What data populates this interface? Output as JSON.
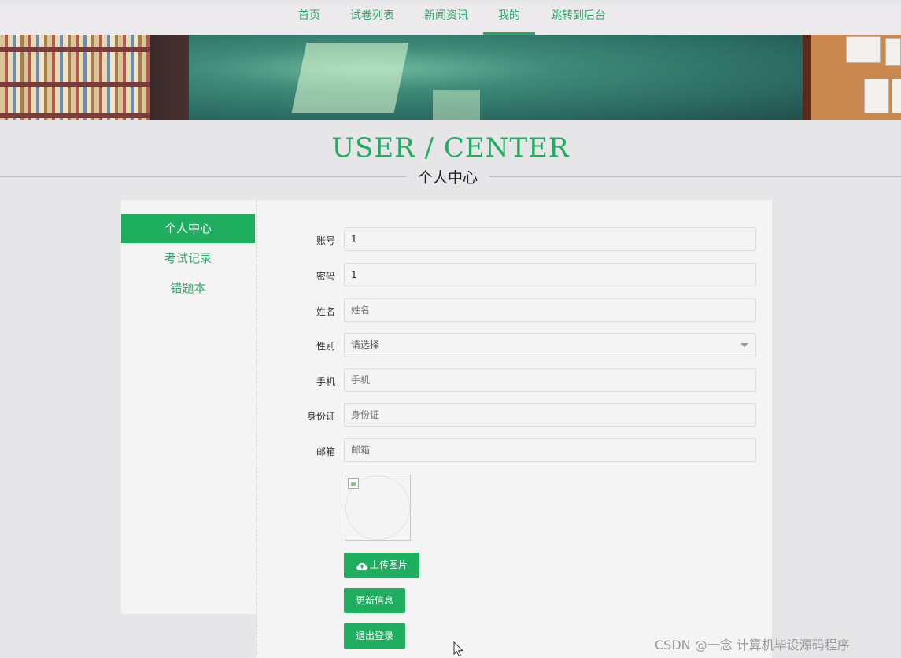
{
  "nav": {
    "items": [
      {
        "label": "首页"
      },
      {
        "label": "试卷列表"
      },
      {
        "label": "新闻资讯"
      },
      {
        "label": "我的"
      },
      {
        "label": "跳转到后台"
      }
    ],
    "active_item": "我的"
  },
  "header": {
    "title_en": "USER / CENTER",
    "title_cn": "个人中心"
  },
  "sidebar": {
    "items": [
      {
        "label": "个人中心"
      },
      {
        "label": "考试记录"
      },
      {
        "label": "错题本"
      }
    ],
    "active_item": "个人中心"
  },
  "form": {
    "account": {
      "label": "账号",
      "value": "1"
    },
    "password": {
      "label": "密码",
      "value": "1"
    },
    "name": {
      "label": "姓名",
      "placeholder": "姓名"
    },
    "gender": {
      "label": "性别",
      "selected": "请选择"
    },
    "phone": {
      "label": "手机",
      "placeholder": "手机"
    },
    "id_card": {
      "label": "身份证",
      "placeholder": "身份证"
    },
    "email": {
      "label": "邮箱",
      "placeholder": "邮箱"
    }
  },
  "buttons": {
    "upload": "上传图片",
    "update": "更新信息",
    "logout": "退出登录"
  },
  "watermark": "CSDN @一念 计算机毕设源码程序",
  "colors": {
    "accent": "#1fae5f",
    "nav_text": "#2fa56a",
    "background": "#e6e6e8",
    "panel": "#f4f4f4"
  },
  "icons": [
    "cloud-upload-icon",
    "caret-down-icon",
    "cursor-icon",
    "broken-image-icon"
  ]
}
